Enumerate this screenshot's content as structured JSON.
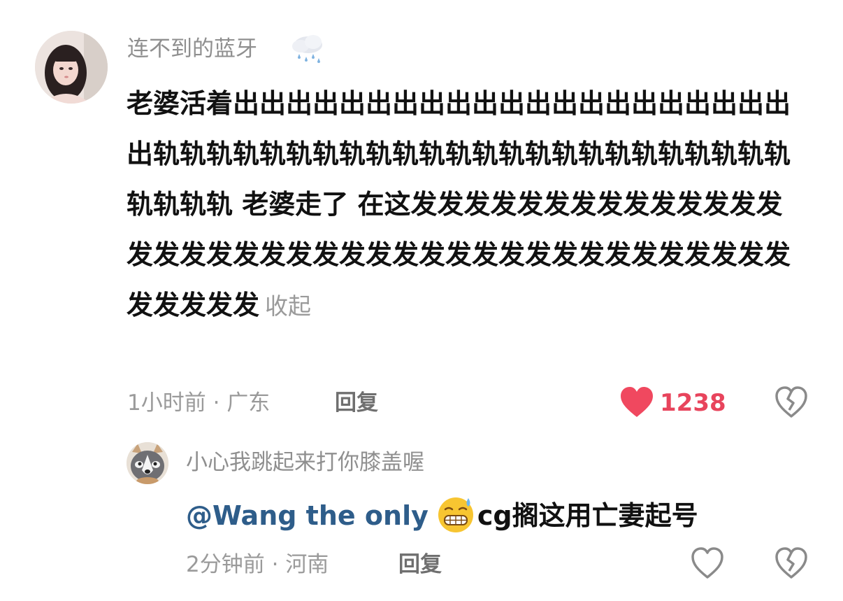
{
  "main_comment": {
    "username": "连不到的蓝牙",
    "username_emoji_icon": "rain-cloud-icon",
    "body": "老婆活着出出出出出出出出出出出出出出出出出出出出出出轨轨轨轨轨轨轨轨轨轨轨轨轨轨轨轨轨轨轨轨轨轨轨轨轨轨轨轨 老婆走了 在这发发发发发发发发发发发发发发发发发发发发发发发发发发发发发发发发发发发发发发发发发发发发",
    "collapse_label": "收起",
    "time": "1小时前",
    "separator": "·",
    "location": "广东",
    "reply_label": "回复",
    "like_count": "1238",
    "liked": true,
    "like_color": "#f0485f",
    "dislike_icon": "broken-heart-icon"
  },
  "reply_comment": {
    "username": "小心我跳起来打你膝盖喔",
    "mention": "@Wang the only",
    "emoji_icon": "grimace-sweat-emoji",
    "text": "cg搁这用亡妻起号",
    "time": "2分钟前",
    "separator": "·",
    "location": "河南",
    "reply_label": "回复",
    "like_icon": "heart-outline-icon",
    "dislike_icon": "broken-heart-icon"
  }
}
